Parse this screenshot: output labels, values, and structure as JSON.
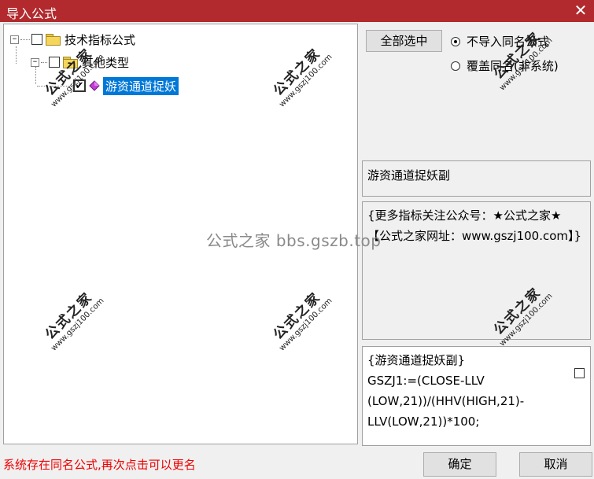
{
  "window": {
    "title": "导入公式",
    "close_glyph": "✕"
  },
  "tree": {
    "root_label": "技术指标公式",
    "child_label": "其他类型",
    "leaf_label": "游资通道捉妖",
    "expander_glyph": "−",
    "leaf_checked_glyph": "✔"
  },
  "options": {
    "select_all_label": "全部选中",
    "radio_skip_label": "不导入同名公式",
    "radio_overwrite_label": "覆盖同名(非系统)",
    "selected_option": "skip"
  },
  "formula": {
    "name": "游资通道捉妖副",
    "description": "{更多指标关注公众号：★公式之家★ 【公式之家网址：www.gszj100.com】}",
    "code": "{游资通道捉妖副}\nGSZJ1:=(CLOSE-LLV\n(LOW,21))/(HHV(HIGH,21)-\nLLV(LOW,21))*100;"
  },
  "status_text": "系统存在同名公式,再次点击可以更名",
  "buttons": {
    "ok_label": "确定",
    "cancel_label": "取消"
  },
  "watermark": {
    "center_text": "公式之家 bbs.gszb.top",
    "stamp_big": "公式之家",
    "stamp_small": "www.gszj100.com"
  },
  "colors": {
    "titlebar": "#b22a2e",
    "selection": "#0078d7",
    "status": "#ee0000"
  }
}
